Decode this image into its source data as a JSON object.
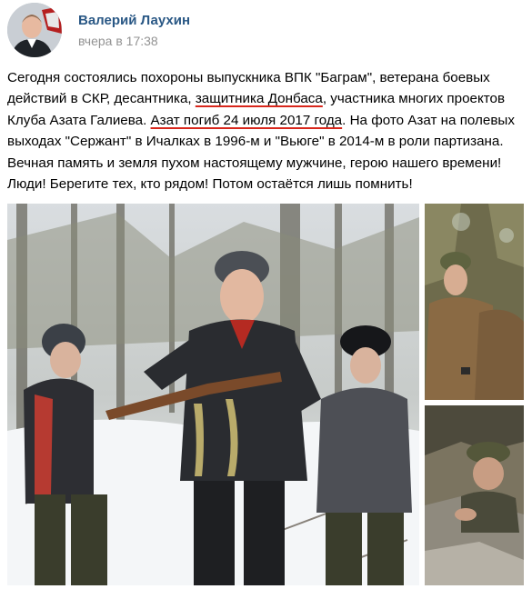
{
  "post": {
    "author": "Валерий Лаухин",
    "time": "вчера в 17:38",
    "text_lines": {
      "l1": "Сегодня состоялись похороны выпускника ВПК \"Баграм\", ветерана боевых",
      "l2_a": "действий в СКР, десантника, ",
      "l2_hl": "защитника Донбаса",
      "l2_b": ", участника многих проектов",
      "l3_a": "Клуба Азата Галиева. ",
      "l3_hl": "Азат погиб 24 июля 2017 года",
      "l3_b": ". На фото Азат на полевых",
      "l4": "выходах \"Сержант\" в Ичалках в 1996-м и \"Вьюге\" в 2014-м в роли партизана.",
      "l5": "Вечная память и земля пухом настоящему мужчине, герою нашего времени!",
      "l6": "Люди! Берегите тех, кто рядом! Потом остаётся лишь помнить!"
    },
    "highlight_color": "#d8261b",
    "link_color": "#2a5885",
    "meta_color": "#939393"
  },
  "photos": [
    {
      "name": "main-photo",
      "subject": "winter forest, man with rifle and two children"
    },
    {
      "name": "side-photo-top",
      "subject": "soldiers sitting in forest"
    },
    {
      "name": "side-photo-bottom",
      "subject": "person in camouflage cap among rocks"
    }
  ]
}
